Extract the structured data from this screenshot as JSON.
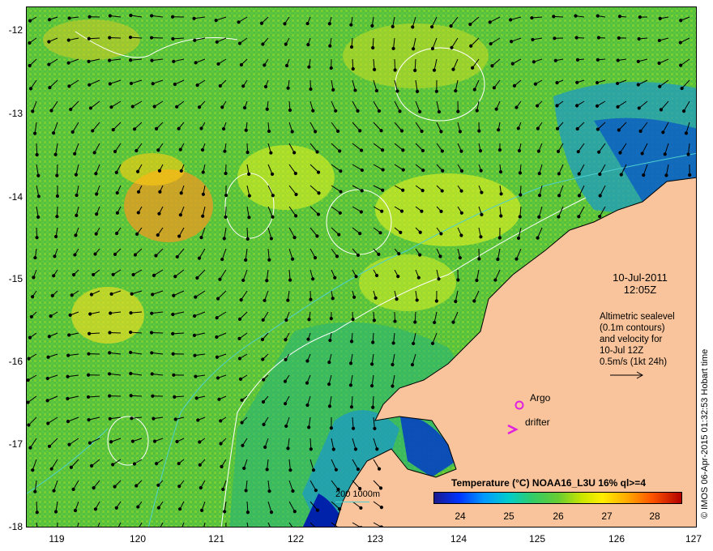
{
  "map": {
    "date": "10-Jul-2011",
    "time": "12:05Z",
    "altimetry_lines": [
      "Altimetric sealevel",
      "(0.1m contours)",
      "and velocity for",
      "10-Jul 12Z",
      "0.5m/s (1kt 24h)"
    ],
    "credit": "© IMOS 06-Apr-2015 01:32:53 Hobart time",
    "lat_labels": [
      "-12",
      "-13",
      "-14",
      "-15",
      "-16",
      "-17",
      "-18"
    ],
    "lon_labels": [
      "119",
      "120",
      "121",
      "122",
      "123",
      "124",
      "125",
      "126",
      "127"
    ],
    "argo_label": "Argo",
    "drifter_label": "drifter",
    "depth_label": "200  1000m",
    "colorbar": {
      "title": "Temperature (°C) NOAA16_L3U 16% ql>=4",
      "ticks": [
        "24",
        "25",
        "26",
        "27",
        "28"
      ]
    },
    "colors": {
      "land": "#f9c49b",
      "argo": "#e020e0",
      "drifter": "#e020e0",
      "contour": "#ffffff",
      "isobath": "#4fd0d0"
    }
  }
}
